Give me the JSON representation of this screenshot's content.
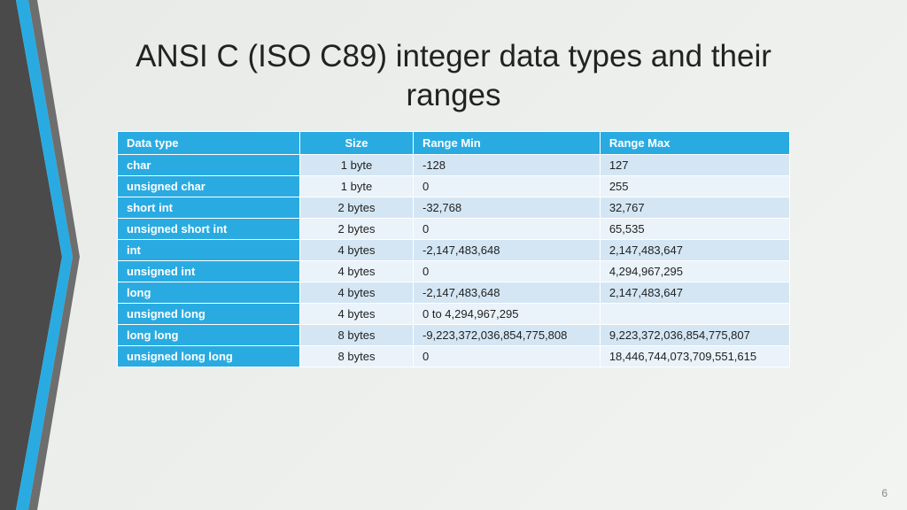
{
  "title": "ANSI C (ISO C89) integer data types and their ranges",
  "page_number": "6",
  "columns": [
    "Data type",
    "Size",
    "Range Min",
    "Range Max"
  ],
  "rows": [
    {
      "type": "char",
      "size": "1 byte",
      "min": "-128",
      "max": "127"
    },
    {
      "type": "unsigned char",
      "size": "1 byte",
      "min": "0",
      "max": "255"
    },
    {
      "type": "short int",
      "size": "2 bytes",
      "min": "-32,768",
      "max": "32,767"
    },
    {
      "type": "unsigned short int",
      "size": "2 bytes",
      "min": "0",
      "max": "65,535"
    },
    {
      "type": "int",
      "size": "4 bytes",
      "min": "-2,147,483,648",
      "max": "2,147,483,647"
    },
    {
      "type": "unsigned int",
      "size": "4 bytes",
      "min": "0",
      "max": "4,294,967,295"
    },
    {
      "type": "long",
      "size": "4 bytes",
      "min": "-2,147,483,648",
      "max": "2,147,483,647"
    },
    {
      "type": "unsigned long",
      "size": "4 bytes",
      "min": "0 to 4,294,967,295",
      "max": ""
    },
    {
      "type": "long long",
      "size": "8 bytes",
      "min": "-9,223,372,036,854,775,808",
      "max": "9,223,372,036,854,775,807"
    },
    {
      "type": "unsigned long long",
      "size": "8 bytes",
      "min": "0",
      "max": "18,446,744,073,709,551,615"
    }
  ]
}
